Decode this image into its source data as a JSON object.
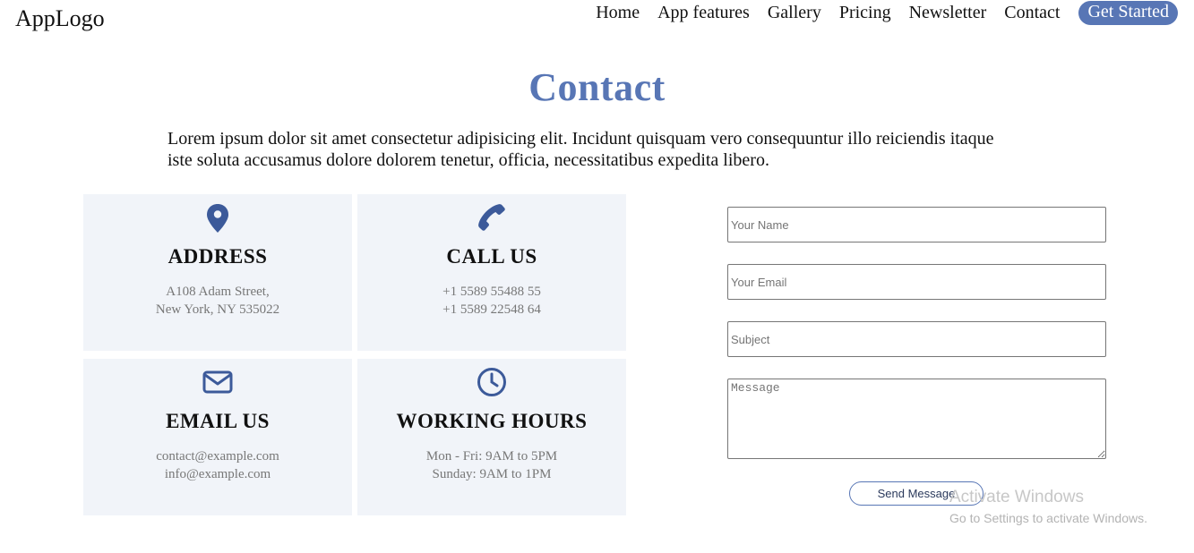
{
  "header": {
    "logo": "AppLogo",
    "nav": [
      "Home",
      "App features",
      "Gallery",
      "Pricing",
      "Newsletter",
      "Contact"
    ],
    "cta": "Get Started"
  },
  "main": {
    "title": "Contact",
    "intro": "Lorem ipsum dolor sit amet consectetur adipisicing elit. Incidunt quisquam vero consequuntur illo reiciendis itaque iste soluta accusamus dolore dolorem tenetur, officia, necessitatibus expedita libero."
  },
  "cards": [
    {
      "icon": "map-marker-icon",
      "title": "ADDRESS",
      "lines": [
        "A108 Adam Street,",
        "New York, NY 535022"
      ]
    },
    {
      "icon": "phone-icon",
      "title": "CALL US",
      "lines": [
        "+1 5589 55488 55",
        "+1 5589 22548 64"
      ]
    },
    {
      "icon": "envelope-icon",
      "title": "EMAIL US",
      "lines": [
        "contact@example.com",
        "info@example.com"
      ]
    },
    {
      "icon": "clock-icon",
      "title": "WORKING HOURS",
      "lines": [
        "Mon - Fri: 9AM to 5PM",
        "Sunday: 9AM to 1PM"
      ]
    }
  ],
  "form": {
    "name_placeholder": "Your Name",
    "email_placeholder": "Your Email",
    "subject_placeholder": "Subject",
    "message_placeholder": "Message",
    "send_label": "Send Message"
  },
  "watermark": {
    "title": "Activate Windows",
    "subtitle": "Go to Settings to activate Windows."
  },
  "colors": {
    "accent": "#5876b5",
    "card_bg": "#f1f4f9",
    "icon": "#3c5a9a"
  }
}
